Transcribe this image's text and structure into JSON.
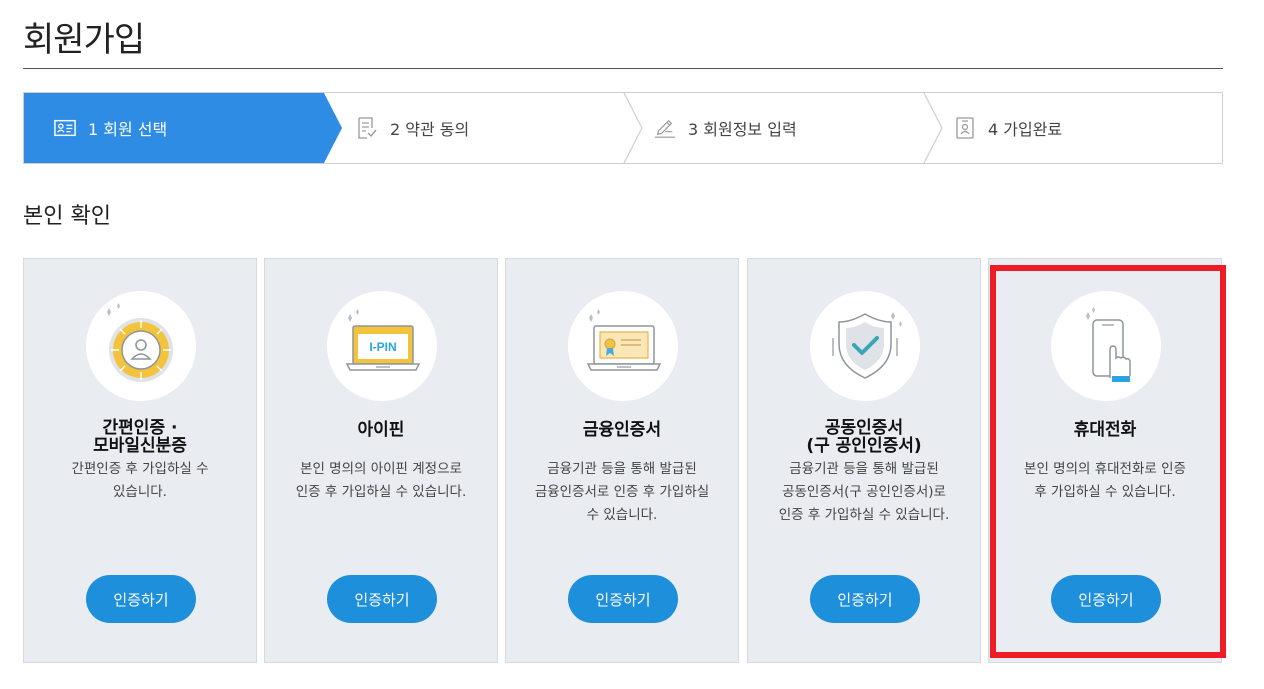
{
  "page": {
    "title": "회원가입"
  },
  "stepper": {
    "steps": [
      {
        "label": "1 회원 선택",
        "icon": "id-card-icon",
        "active": true
      },
      {
        "label": "2 약관 동의",
        "icon": "document-check-icon",
        "active": false
      },
      {
        "label": "3 회원정보 입력",
        "icon": "pencil-form-icon",
        "active": false
      },
      {
        "label": "4 가입완료",
        "icon": "badge-icon",
        "active": false
      }
    ]
  },
  "section": {
    "title": "본인 확인"
  },
  "cards": [
    {
      "title": "간편인증 ·\n모바일신분증",
      "desc": "간편인증 후 가입하실 수\n있습니다.",
      "button": "인증하기",
      "icon": "simple-auth-icon"
    },
    {
      "title": "아이핀",
      "desc": "본인 명의의 아이핀 계정으로\n인증 후 가입하실 수 있습니다.",
      "button": "인증하기",
      "icon": "ipin-laptop-icon",
      "icon_text": "I-PIN"
    },
    {
      "title": "금융인증서",
      "desc": "금융기관 등을 통해 발급된\n금융인증서로 인증 후 가입하실\n수 있습니다.",
      "button": "인증하기",
      "icon": "certificate-laptop-icon"
    },
    {
      "title": "공동인증서\n(구 공인인증서)",
      "desc": "금융기관 등을 통해 발급된\n공동인증서(구 공인인증서)로\n인증 후 가입하실 수 있습니다.",
      "button": "인증하기",
      "icon": "shield-check-icon"
    },
    {
      "title": "휴대전화",
      "desc": "본인 명의의 휴대전화로 인증\n후 가입하실 수 있습니다.",
      "button": "인증하기",
      "icon": "mobile-phone-icon"
    }
  ],
  "colors": {
    "accent": "#1d8fdb",
    "step_active": "#2f8ce5",
    "highlight": "#ee1c25",
    "card_bg": "#e9ecf1"
  }
}
